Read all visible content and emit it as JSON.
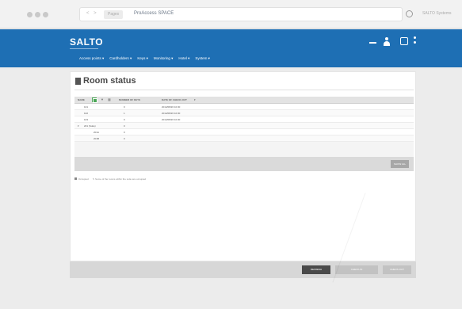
{
  "browser": {
    "nav_arrows": "< >",
    "tab_badge": "Pages",
    "url_text": "ProAccess SPACE",
    "user_label": "SALTO Systems"
  },
  "header": {
    "logo": "SALTO",
    "menu": [
      {
        "label": "Access points ▾"
      },
      {
        "label": "Cardholders ▾"
      },
      {
        "label": "Keys ▾"
      },
      {
        "label": "Monitoring ▾"
      },
      {
        "label": "Hotel ▾"
      },
      {
        "label": "System ▾"
      }
    ]
  },
  "page": {
    "title": "Room status"
  },
  "table": {
    "columns": {
      "name": "NAME",
      "guests": "NUMBER OF KEYS",
      "checkout": "DATE OF CHECK-OUT",
      "sort": "▾"
    },
    "rows": [
      {
        "toggle": "",
        "name": "101",
        "guests": "0",
        "checkout": "2014/08/26 10:30"
      },
      {
        "toggle": "",
        "name": "102",
        "guests": "1",
        "checkout": "2014/08/26 10:30"
      },
      {
        "toggle": "",
        "name": "103",
        "guests": "0",
        "checkout": "2014/08/26 10:30"
      },
      {
        "toggle": "▾",
        "name": "201 (Suite)",
        "guests": "0",
        "checkout": ""
      },
      {
        "toggle": "",
        "name": "201A",
        "guests": "0",
        "checkout": ""
      },
      {
        "toggle": "",
        "name": "201B",
        "guests": "0",
        "checkout": ""
      }
    ],
    "show_all_label": "SHOW ALL"
  },
  "legend": {
    "occupied": "Occupied",
    "subroom": "Some of the rooms within the suite are occupied"
  },
  "actions": {
    "refresh": "REFRESH",
    "check_in": "CHECK-IN",
    "check_out": "CHECK-OUT"
  }
}
